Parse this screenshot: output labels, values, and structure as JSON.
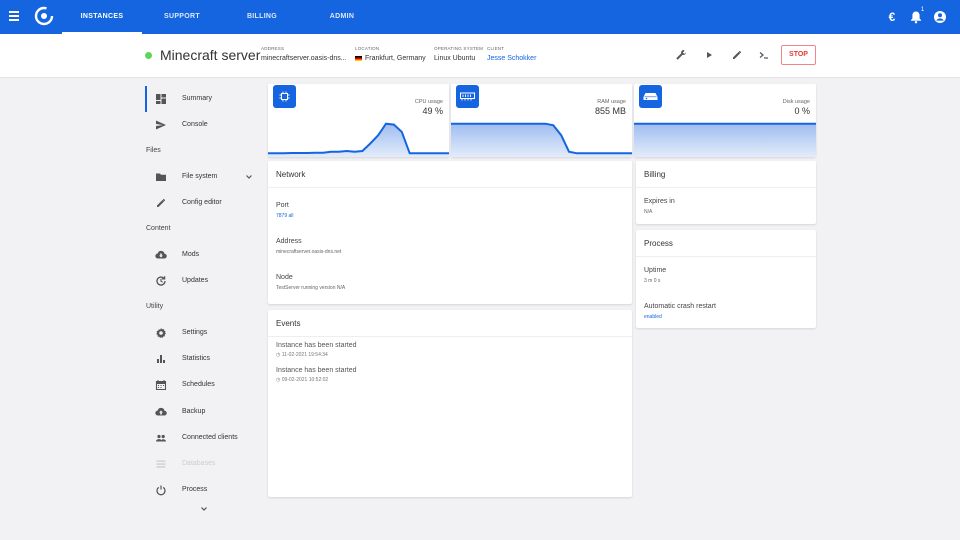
{
  "topbar": {
    "tabs": [
      {
        "label": "INSTANCES",
        "active": true
      },
      {
        "label": "SUPPORT",
        "active": false
      },
      {
        "label": "BILLING",
        "active": false
      },
      {
        "label": "ADMIN",
        "active": false
      }
    ],
    "currency_icon": "€",
    "notification_count": "1"
  },
  "server": {
    "status": "online",
    "name": "Minecraft server",
    "address_label": "ADDRESS",
    "address_value": "minecraftserver.oasis-dns...",
    "location_label": "LOCATION",
    "location_value": "Frankfurt, Germany",
    "os_label": "OPERATING SYSTEM",
    "os_value": "Linux Ubuntu",
    "client_label": "CLIENT",
    "client_value": "Jesse Schokker",
    "stop_label": "STOP"
  },
  "sidebar": {
    "items": [
      {
        "label": "Summary",
        "icon": "dashboard-icon",
        "active": true
      },
      {
        "label": "Console",
        "icon": "send-icon"
      }
    ],
    "files_section": "Files",
    "files_items": [
      {
        "label": "File system",
        "icon": "folder-icon"
      },
      {
        "label": "Config editor",
        "icon": "pencil-icon"
      }
    ],
    "content_section": "Content",
    "content_items": [
      {
        "label": "Mods",
        "icon": "cloud-download-icon"
      },
      {
        "label": "Updates",
        "icon": "update-icon"
      }
    ],
    "utility_section": "Utility",
    "utility_items": [
      {
        "label": "Settings",
        "icon": "gear-icon"
      },
      {
        "label": "Statistics",
        "icon": "bar-chart-icon"
      },
      {
        "label": "Schedules",
        "icon": "calendar-icon"
      },
      {
        "label": "Backup",
        "icon": "cloud-upload-icon"
      },
      {
        "label": "Connected clients",
        "icon": "people-icon"
      },
      {
        "label": "Databases",
        "icon": "list-icon",
        "disabled": true
      },
      {
        "label": "Process",
        "icon": "power-icon"
      }
    ]
  },
  "metrics": {
    "cpu": {
      "label": "CPU usage",
      "value": "49 %",
      "series": [
        0.05,
        0.05,
        0.05,
        0.06,
        0.06,
        0.06,
        0.07,
        0.07,
        0.1,
        0.1,
        0.12,
        0.1,
        0.12,
        0.35,
        0.6,
        0.95,
        0.92,
        0.7,
        0.05,
        0.05,
        0.05,
        0.05,
        0.05,
        0.05
      ]
    },
    "ram": {
      "label": "RAM usage",
      "value": "855 MB",
      "series": [
        0.95,
        0.95,
        0.95,
        0.95,
        0.95,
        0.95,
        0.95,
        0.95,
        0.95,
        0.95,
        0.95,
        0.95,
        0.95,
        0.9,
        0.6,
        0.1,
        0.05,
        0.05,
        0.05,
        0.05,
        0.05,
        0.05,
        0.05,
        0.05
      ]
    },
    "disk": {
      "label": "Disk usage",
      "value": "0 %",
      "series": [
        0.95,
        0.95,
        0.95,
        0.95,
        0.95,
        0.95,
        0.95,
        0.95,
        0.95,
        0.95,
        0.95,
        0.95,
        0.95,
        0.95,
        0.95,
        0.95,
        0.95,
        0.95,
        0.95,
        0.95,
        0.95,
        0.95,
        0.95,
        0.95
      ]
    }
  },
  "network": {
    "title": "Network",
    "port_label": "Port",
    "port_value": "7879 all",
    "address_label": "Address",
    "address_value": "minecraftserver.oasis-dns.net",
    "node_label": "Node",
    "node_value": "TestServer running version N/A"
  },
  "events": {
    "title": "Events",
    "items": [
      {
        "title": "Instance has been started",
        "time": "11-02-2021 19:54:34"
      },
      {
        "title": "Instance has been started",
        "time": "09-02-2021 10:52:02"
      }
    ]
  },
  "billing": {
    "title": "Billing",
    "expires_label": "Expires in",
    "expires_value": "N/A"
  },
  "process": {
    "title": "Process",
    "uptime_label": "Uptime",
    "uptime_value": "3 m 0 s",
    "crash_label": "Automatic crash restart",
    "crash_value": "enabled"
  },
  "colors": {
    "accent": "#1565e0",
    "online": "#5ad65a",
    "stop": "#e53935"
  }
}
